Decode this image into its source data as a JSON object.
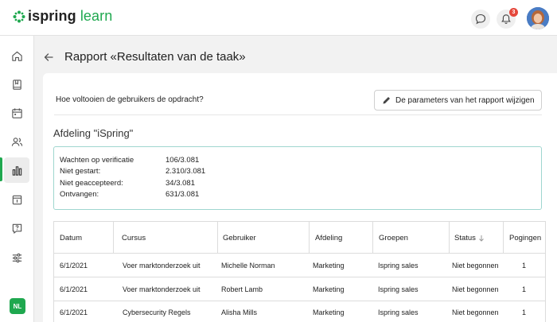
{
  "app": {
    "logo_part1": "ispring",
    "logo_part2": "learn",
    "notification_count": "3"
  },
  "sidebar": {
    "items": [
      {
        "name": "home-icon"
      },
      {
        "name": "book-icon"
      },
      {
        "name": "calendar-icon"
      },
      {
        "name": "users-icon"
      },
      {
        "name": "bar-chart-icon"
      },
      {
        "name": "info-icon"
      },
      {
        "name": "help-icon"
      },
      {
        "name": "sliders-icon"
      }
    ],
    "active_item": "bar-chart-icon",
    "user_initials": "NL"
  },
  "page": {
    "title": "Rapport «Resultaten van de taak»"
  },
  "report": {
    "question": "Hoe voltooien de gebruikers de opdracht?",
    "param_button": "De parameters van het rapport wijzigen",
    "department_title": "Afdeling \"iSpring\"",
    "stats": [
      {
        "label": "Wachten op verificatie",
        "value": "106/3.081"
      },
      {
        "label": "Niet gestart:",
        "value": "2.310/3.081"
      },
      {
        "label": "Niet geaccepteerd:",
        "value": "34/3.081"
      },
      {
        "label": "Ontvangen:",
        "value": "631/3.081"
      }
    ]
  },
  "table": {
    "headers": [
      "Datum",
      "Cursus",
      "Gebruiker",
      "Afdeling",
      "Groepen",
      "Status",
      "Pogingen"
    ],
    "rows": [
      [
        "6/1/2021",
        "Voer marktonderzoek uit",
        "Michelle Norman",
        "Marketing",
        "Ispring sales",
        "Niet begonnen",
        "1"
      ],
      [
        "6/1/2021",
        "Voer marktonderzoek uit",
        "Robert Lamb",
        "Marketing",
        "Ispring sales",
        "Niet begonnen",
        "1"
      ],
      [
        "6/1/2021",
        "Cybersecurity Regels",
        "Alisha Mills",
        "Marketing",
        "Ispring sales",
        "Niet begonnen",
        "1"
      ]
    ]
  },
  "colors": {
    "brand_green": "#1fa84f",
    "badge_red": "#e5483c",
    "stats_border": "#9fd6cf"
  }
}
